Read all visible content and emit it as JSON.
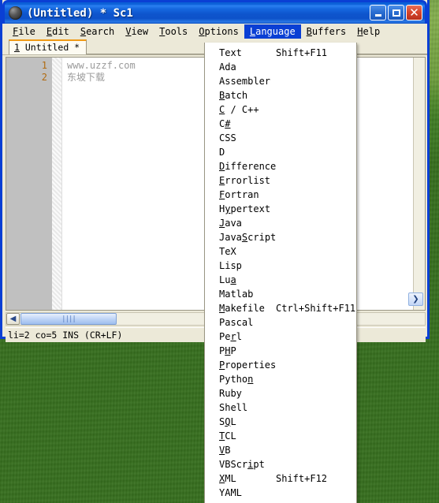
{
  "window": {
    "title": "(Untitled) * Sc1",
    "icon": "sphere-icon",
    "buttons": {
      "minimize": "minimize-icon",
      "maximize": "maximize-icon",
      "close": "close-icon"
    }
  },
  "menubar": {
    "items": [
      {
        "label": "File",
        "mnemonic": "F",
        "active": false
      },
      {
        "label": "Edit",
        "mnemonic": "E",
        "active": false
      },
      {
        "label": "Search",
        "mnemonic": "S",
        "active": false
      },
      {
        "label": "View",
        "mnemonic": "V",
        "active": false
      },
      {
        "label": "Tools",
        "mnemonic": "T",
        "active": false
      },
      {
        "label": "Options",
        "mnemonic": "O",
        "active": false
      },
      {
        "label": "Language",
        "mnemonic": "L",
        "active": true
      },
      {
        "label": "Buffers",
        "mnemonic": "B",
        "active": false
      },
      {
        "label": "Help",
        "mnemonic": "H",
        "active": false
      }
    ]
  },
  "tabs": [
    {
      "label": "1 Untitled *",
      "mnemonic": "1",
      "selected": true
    }
  ],
  "editor": {
    "line_numbers": [
      "1",
      "2"
    ],
    "lines": [
      "www.uzzf.com",
      "东坡下载"
    ],
    "text_color": "#9b9b9b",
    "gutter_color": "#c0c0c0",
    "line_number_color": "#b06a10"
  },
  "scrollbars": {
    "h_left_arrow": "◀",
    "h_thumb_grip": "||||",
    "v_right_arrow": "❯"
  },
  "statusbar": {
    "text": "li=2 co=5 INS (CR+LF)"
  },
  "language_menu": {
    "title": "Language",
    "items": [
      {
        "label": "Text",
        "mnemonic": "",
        "accel": "Shift+F11"
      },
      {
        "label": "Ada",
        "mnemonic": "",
        "accel": ""
      },
      {
        "label": "Assembler",
        "mnemonic": "",
        "accel": ""
      },
      {
        "label": "Batch",
        "mnemonic": "B",
        "accel": ""
      },
      {
        "label": "C / C++",
        "mnemonic": "C",
        "accel": ""
      },
      {
        "label": "C#",
        "mnemonic": "#",
        "accel": ""
      },
      {
        "label": "CSS",
        "mnemonic": "",
        "accel": ""
      },
      {
        "label": "D",
        "mnemonic": "",
        "accel": ""
      },
      {
        "label": "Difference",
        "mnemonic": "D",
        "accel": ""
      },
      {
        "label": "Errorlist",
        "mnemonic": "E",
        "accel": ""
      },
      {
        "label": "Fortran",
        "mnemonic": "F",
        "accel": ""
      },
      {
        "label": "Hypertext",
        "mnemonic": "y",
        "accel": ""
      },
      {
        "label": "Java",
        "mnemonic": "J",
        "accel": ""
      },
      {
        "label": "JavaScript",
        "mnemonic": "S",
        "accel": ""
      },
      {
        "label": "TeX",
        "mnemonic": "",
        "accel": ""
      },
      {
        "label": "Lisp",
        "mnemonic": "",
        "accel": ""
      },
      {
        "label": "Lua",
        "mnemonic": "a",
        "accel": ""
      },
      {
        "label": "Matlab",
        "mnemonic": "",
        "accel": ""
      },
      {
        "label": "Makefile",
        "mnemonic": "M",
        "accel": "Ctrl+Shift+F11"
      },
      {
        "label": "Pascal",
        "mnemonic": "",
        "accel": ""
      },
      {
        "label": "Perl",
        "mnemonic": "r",
        "accel": ""
      },
      {
        "label": "PHP",
        "mnemonic": "H",
        "accel": ""
      },
      {
        "label": "Properties",
        "mnemonic": "P",
        "accel": ""
      },
      {
        "label": "Python",
        "mnemonic": "n",
        "accel": ""
      },
      {
        "label": "Ruby",
        "mnemonic": "",
        "accel": ""
      },
      {
        "label": "Shell",
        "mnemonic": "",
        "accel": ""
      },
      {
        "label": "SQL",
        "mnemonic": "Q",
        "accel": ""
      },
      {
        "label": "TCL",
        "mnemonic": "T",
        "accel": ""
      },
      {
        "label": "VB",
        "mnemonic": "V",
        "accel": ""
      },
      {
        "label": "VBScript",
        "mnemonic": "i",
        "accel": ""
      },
      {
        "label": "XML",
        "mnemonic": "X",
        "accel": "Shift+F12"
      },
      {
        "label": "YAML",
        "mnemonic": "",
        "accel": ""
      }
    ]
  },
  "desktop": {
    "wallpaper": "bliss-green-hills"
  },
  "colors": {
    "titlebar_blue": "#0d55cd",
    "menu_highlight": "#0a3fd4",
    "window_face": "#ece9d8",
    "tab_accent": "#ef9a16",
    "close_red": "#d8462c"
  }
}
